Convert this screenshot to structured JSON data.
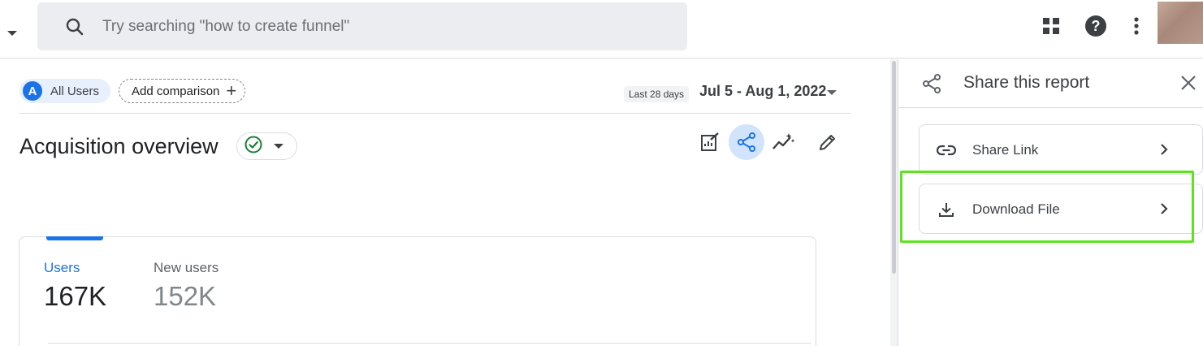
{
  "search": {
    "placeholder": "Try searching \"how to create funnel\""
  },
  "topbar_icons": [
    "apps-grid-icon",
    "help-icon",
    "more-vert-icon",
    "avatar"
  ],
  "filters": {
    "segment_avatar_letter": "A",
    "segment_label": "All Users",
    "add_comparison_label": "Add comparison",
    "date_badge": "Last 28 days",
    "date_range": "Jul 5 - Aug 1, 2022"
  },
  "report": {
    "title": "Acquisition overview",
    "actions": [
      "edit-report-icon",
      "share-icon",
      "insights-icon",
      "pencil-icon"
    ],
    "active_action": "share-icon"
  },
  "metrics": [
    {
      "label": "Users",
      "value": "167K",
      "active": true
    },
    {
      "label": "New users",
      "value": "152K",
      "active": false
    }
  ],
  "share_panel": {
    "title": "Share this report",
    "options": [
      {
        "label": "Share Link",
        "icon": "link-icon"
      },
      {
        "label": "Download File",
        "icon": "download-icon",
        "highlighted": true
      }
    ]
  },
  "colors": {
    "accent": "#1a73e8",
    "active_chip": "#e8f0fe",
    "highlight": "#5ee31f",
    "success": "#188038"
  }
}
